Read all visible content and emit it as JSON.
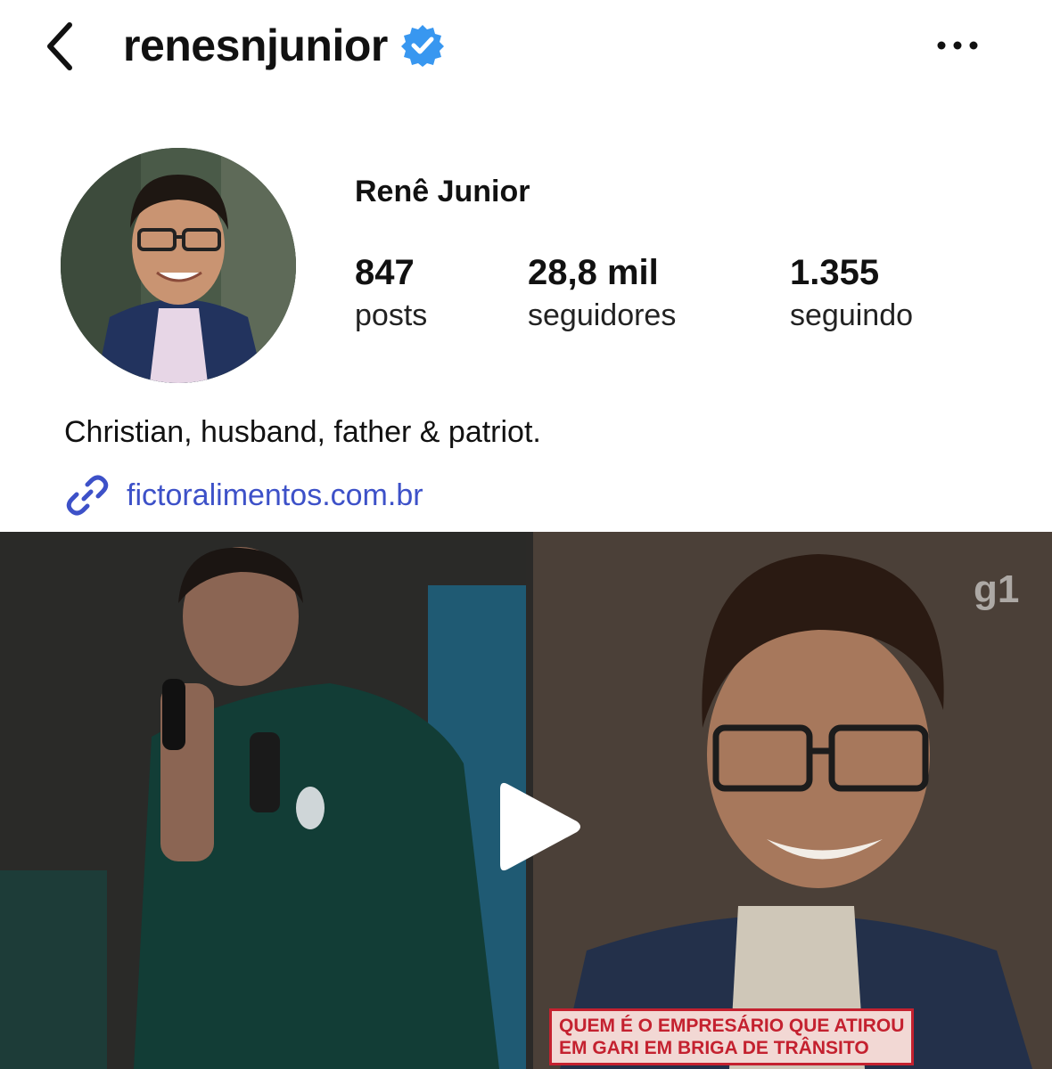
{
  "header": {
    "username": "renesnjunior",
    "verified": true
  },
  "profile": {
    "display_name": "Renê Junior",
    "stats": [
      {
        "value": "847",
        "label": "posts"
      },
      {
        "value": "28,8 mil",
        "label": "seguidores"
      },
      {
        "value": "1.355",
        "label": "seguindo"
      }
    ],
    "bio": "Christian, husband, father & patriot.",
    "link": "fictoralimentos.com.br"
  },
  "post": {
    "watermark": "g1",
    "caption_line1": "QUEM É O EMPRESÁRIO QUE ATIROU",
    "caption_line2": "EM GARI EM BRIGA DE TRÂNSITO"
  },
  "colors": {
    "verified": "#3897f0",
    "link": "#3d51c8",
    "caption_red": "#c4212f"
  },
  "icons": [
    "chevron-left-icon",
    "verified-badge-icon",
    "more-horizontal-icon",
    "link-icon",
    "play-icon"
  ]
}
